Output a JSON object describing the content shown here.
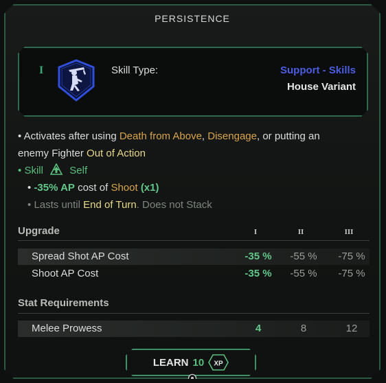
{
  "title": "PERSISTENCE",
  "tier_mark": "I",
  "skill_type_label": "Skill Type:",
  "skill_category": "Support - Skills",
  "skill_variant": "House Variant",
  "description": {
    "line1_prefix": "• Activates after using",
    "ability1": "Death from Above",
    "comma1": ",",
    "ability2": "Disengage",
    "line1_suffix": ", or putting an",
    "line2_prefix": "enemy Fighter",
    "status1": "Out of Action",
    "skill_bullet": "•",
    "skill_word": "Skill",
    "self_word": "Self",
    "effect_bullet": "•",
    "effect_amount": "-35% AP",
    "effect_mid": "cost of",
    "effect_target": "Shoot",
    "effect_mult": "(x1)",
    "duration_bullet": "•",
    "duration_prefix": "Lasts until",
    "duration_status": "End of Turn",
    "duration_suffix": ". Does not Stack"
  },
  "upgrade": {
    "title": "Upgrade",
    "tiers": [
      "I",
      "II",
      "III"
    ],
    "rows": [
      {
        "label": "Spread Shot AP Cost",
        "values": [
          "-35 %",
          "-55 %",
          "-75 %"
        ]
      },
      {
        "label": "Shoot AP Cost",
        "values": [
          "-35 %",
          "-55 %",
          "-75 %"
        ]
      }
    ]
  },
  "requirements": {
    "title": "Stat Requirements",
    "rows": [
      {
        "label": "Melee Prowess",
        "values": [
          "4",
          "8",
          "12"
        ]
      }
    ]
  },
  "learn_button": {
    "label": "LEARN",
    "cost": "10",
    "currency": "XP"
  },
  "colors": {
    "accent_green": "#5bbf7d",
    "border_green": "#2c5a44",
    "category_blue": "#4b5de0",
    "ability_orange": "#d9a54a",
    "status_yellow": "#e8d98a"
  },
  "icons": {
    "skill": "fighter-figure-icon",
    "skill_type": "up-arrow-triangle-icon",
    "xp": "xp-hexagon-icon",
    "target": "target-icon"
  }
}
